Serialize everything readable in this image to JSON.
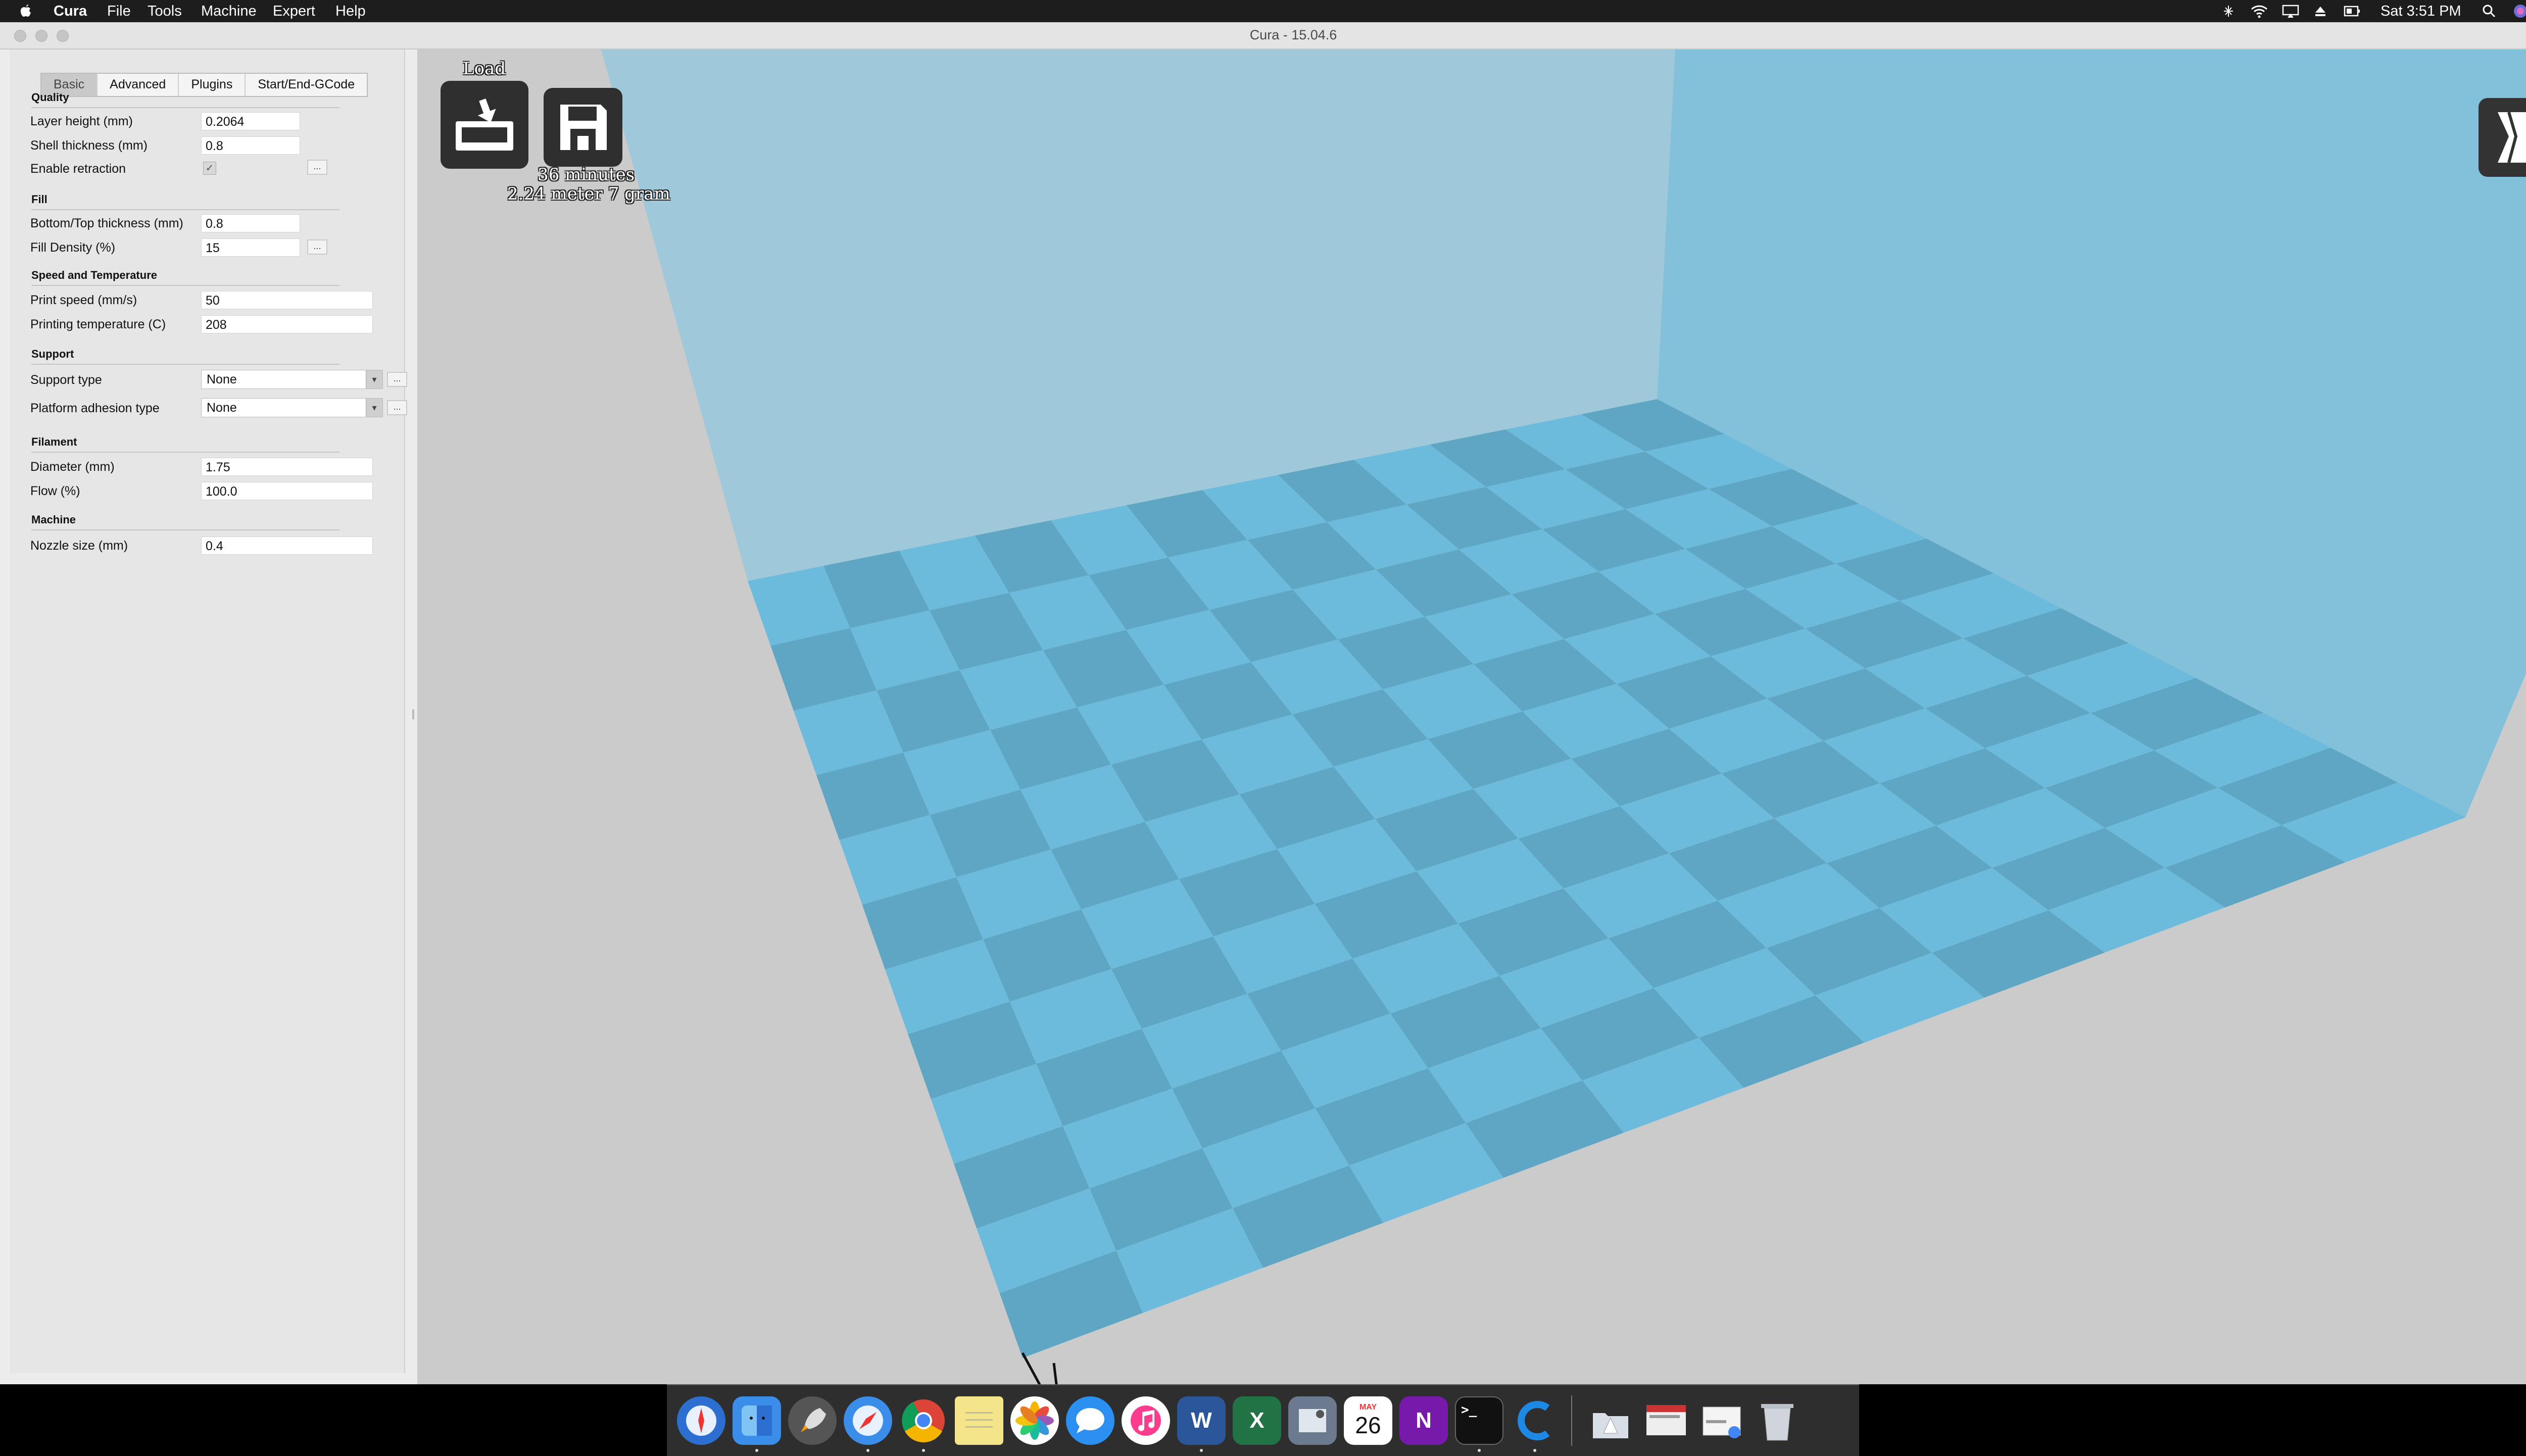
{
  "menubar": {
    "app_name": "Cura",
    "items": [
      "File",
      "Tools",
      "Machine",
      "Expert",
      "Help"
    ],
    "clock": "Sat 3:51 PM"
  },
  "window": {
    "title": "Cura - 15.04.6"
  },
  "sidebar": {
    "tabs": [
      "Basic",
      "Advanced",
      "Plugins",
      "Start/End-GCode"
    ],
    "sections": {
      "quality": "Quality",
      "fill": "Fill",
      "speed": "Speed and Temperature",
      "support": "Support",
      "filament": "Filament",
      "machine": "Machine"
    },
    "fields": {
      "layer_height": {
        "label": "Layer height (mm)",
        "value": "0.2064"
      },
      "shell_thickness": {
        "label": "Shell thickness (mm)",
        "value": "0.8"
      },
      "enable_retraction": {
        "label": "Enable retraction",
        "checked": true
      },
      "bottom_top_thickness": {
        "label": "Bottom/Top thickness (mm)",
        "value": "0.8"
      },
      "fill_density": {
        "label": "Fill Density (%)",
        "value": "15"
      },
      "print_speed": {
        "label": "Print speed (mm/s)",
        "value": "50"
      },
      "print_temp": {
        "label": "Printing temperature (C)",
        "value": "208"
      },
      "support_type": {
        "label": "Support type",
        "value": "None"
      },
      "adhesion_type": {
        "label": "Platform adhesion type",
        "value": "None"
      },
      "diameter": {
        "label": "Diameter (mm)",
        "value": "1.75"
      },
      "flow": {
        "label": "Flow (%)",
        "value": "100.0"
      },
      "nozzle_size": {
        "label": "Nozzle size (mm)",
        "value": "0.4"
      }
    },
    "more_button": "..."
  },
  "viewport": {
    "load_label": "Load",
    "print_time": "36 minutes",
    "print_material": "2.24 meter 7 gram"
  },
  "dock": {
    "calendar_month": "MAY",
    "calendar_day": "26",
    "word_letter": "W",
    "excel_letter": "X",
    "onenote_letter": "N"
  },
  "colors": {
    "plate_light": "#6cbbdc",
    "plate_dark": "#5ea6c4",
    "wall_back": "#9fc8db",
    "wall_right": "#83c0da",
    "floor": "#cbcbcb"
  }
}
